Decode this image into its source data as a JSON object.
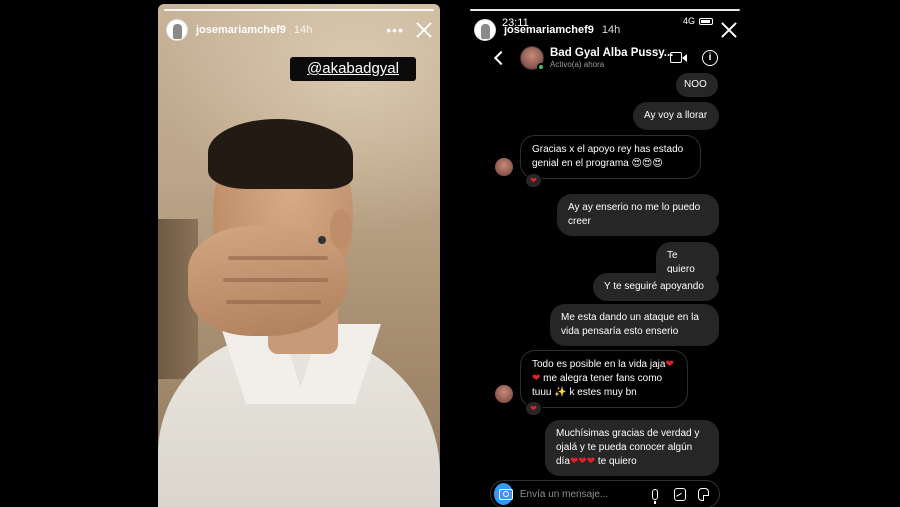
{
  "left_story": {
    "username": "josemariamchef9",
    "time": "14h",
    "more_label": "•••",
    "mention": "@akabadgyal"
  },
  "right_story": {
    "username": "josemariamchef9",
    "time": "14h",
    "status_bar": {
      "clock": "23:11",
      "network": "4G"
    },
    "chat": {
      "name": "Bad Gyal Alba Pussy...",
      "status": "Activo(a) ahora",
      "info_label": "i"
    },
    "messages": [
      {
        "from": "me",
        "text": "NOO"
      },
      {
        "from": "me",
        "text": "Ay voy a llorar"
      },
      {
        "from": "them",
        "text": "Gracias x el apoyo rey has estado genial en el programa 😍😍😍",
        "reaction": "❤"
      },
      {
        "from": "me",
        "text": "Ay ay enserio no me lo puedo creer"
      },
      {
        "from": "me",
        "text": "Te quiero"
      },
      {
        "from": "me",
        "text": "Y te seguiré apoyando"
      },
      {
        "from": "me",
        "text": "Me esta dando un ataque en la vida pensaría esto enserio"
      },
      {
        "from": "them",
        "text_a": "Todo es posible en la vida jaja",
        "hearts_a": "❤❤",
        "text_b": " me alegra tener fans como tuuu ✨ k estes muy bn",
        "reaction": "❤"
      },
      {
        "from": "me",
        "text_a": "Muchísimas gracias de verdad y ojalá y te pueda conocer algún día",
        "hearts_a": "❤❤❤",
        "text_b": " te quiero"
      }
    ],
    "composer": {
      "placeholder": "Envía un mensaje..."
    }
  },
  "colors": {
    "bubble_out": "#262626",
    "accent_blue": "#3897f0",
    "online_green": "#3cc35a",
    "heart_red": "#e0202a"
  }
}
